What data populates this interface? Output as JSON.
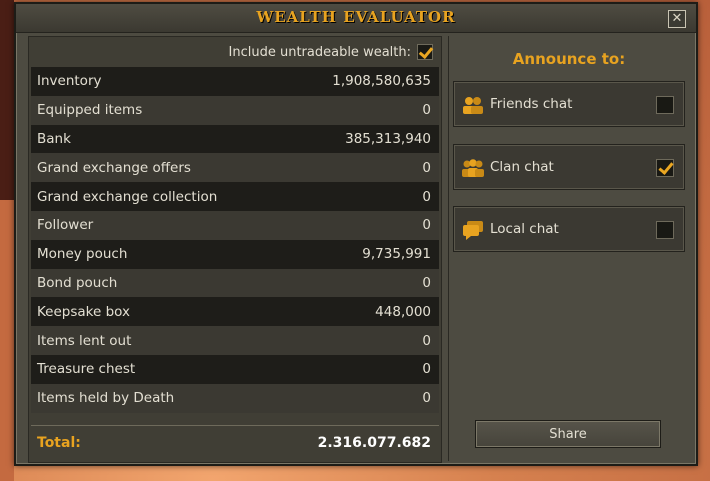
{
  "window": {
    "title": "WEALTH EVALUATOR",
    "close_glyph": "✕"
  },
  "include": {
    "label": "Include untradeable wealth:",
    "checked": true
  },
  "rows": [
    {
      "label": "Inventory",
      "value": "1,908,580,635"
    },
    {
      "label": "Equipped items",
      "value": "0"
    },
    {
      "label": "Bank",
      "value": "385,313,940"
    },
    {
      "label": "Grand exchange offers",
      "value": "0"
    },
    {
      "label": "Grand exchange collection",
      "value": "0"
    },
    {
      "label": "Follower",
      "value": "0"
    },
    {
      "label": "Money pouch",
      "value": "9,735,991"
    },
    {
      "label": "Bond pouch",
      "value": "0"
    },
    {
      "label": "Keepsake box",
      "value": "448,000"
    },
    {
      "label": "Items lent out",
      "value": "0"
    },
    {
      "label": "Treasure chest",
      "value": "0"
    },
    {
      "label": "Items held by Death",
      "value": "0"
    }
  ],
  "total": {
    "label": "Total:",
    "value": "2.316.077.682"
  },
  "announce": {
    "title": "Announce to:",
    "options": [
      {
        "label": "Friends chat",
        "icon": "friends-chat-icon",
        "checked": false
      },
      {
        "label": "Clan chat",
        "icon": "clan-chat-icon",
        "checked": true
      },
      {
        "label": "Local chat",
        "icon": "local-chat-icon",
        "checked": false
      }
    ]
  },
  "share": {
    "label": "Share"
  },
  "colors": {
    "accent": "#e8a320",
    "text": "#e3dfd2",
    "panel": "#4d4b41"
  }
}
